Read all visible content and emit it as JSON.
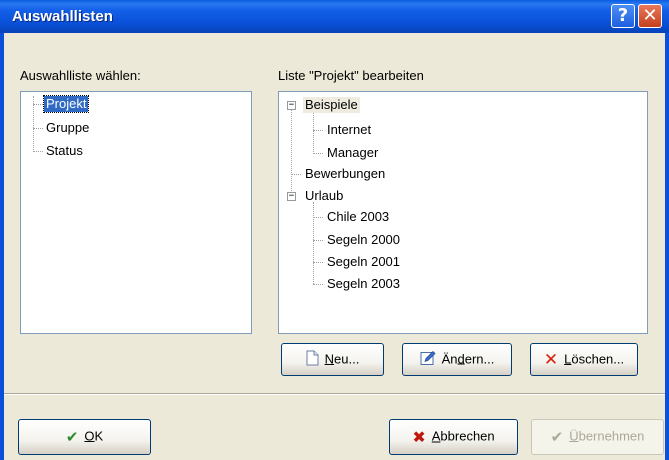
{
  "window": {
    "title": "Auswahllisten",
    "help_glyph": "?",
    "close_glyph": "✕"
  },
  "left": {
    "label": "Auswahlliste wählen:",
    "items": [
      "Projekt",
      "Gruppe",
      "Status"
    ],
    "selected": "Projekt"
  },
  "right": {
    "label": "Liste \"Projekt\" bearbeiten",
    "tree": {
      "beispiele": "Beispiele",
      "internet": "Internet",
      "manager": "Manager",
      "bewerbungen": "Bewerbungen",
      "urlaub": "Urlaub",
      "chile": "Chile 2003",
      "segeln2000": "Segeln 2000",
      "segeln2001": "Segeln 2001",
      "segeln2003": "Segeln 2003"
    }
  },
  "buttons": {
    "neu": {
      "label_u": "N",
      "label_rest": "eu...",
      "icon": "new-document-icon"
    },
    "aendern": {
      "label_pre": "Än",
      "label_u": "d",
      "label_rest": "ern...",
      "icon": "edit-icon"
    },
    "loeschen": {
      "label_u": "L",
      "label_rest": "öschen...",
      "icon": "delete-x-icon"
    },
    "ok": {
      "label_u": "O",
      "label_rest": "K",
      "icon": "checkmark-icon"
    },
    "abbrechen": {
      "label_u": "A",
      "label_rest": "bbrechen",
      "icon": "cancel-x-icon"
    },
    "uebernehmen": {
      "label_u": "Ü",
      "label_rest": "bernehmen",
      "icon": "checkmark-icon",
      "disabled": true
    }
  },
  "colors": {
    "titlebar": "#0a50d8",
    "selection": "#316ac5",
    "dialog_bg": "#ece9d8",
    "check_green": "#2e8b2e",
    "delete_red": "#d82010"
  }
}
